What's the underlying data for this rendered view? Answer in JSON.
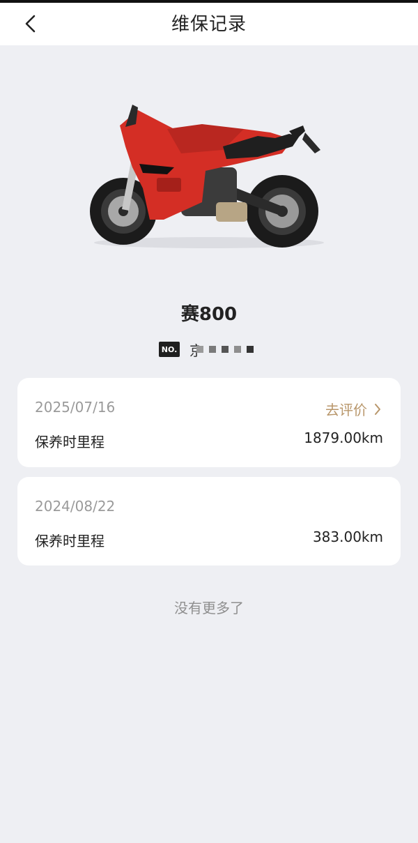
{
  "header": {
    "title": "维保记录"
  },
  "vehicle": {
    "model": "赛800",
    "plate_badge": "NO.",
    "plate_prefix": "京",
    "body_color": "#d42e25"
  },
  "records": [
    {
      "date": "2025/07/16",
      "action_label": "去评价",
      "mileage_label": "保养时里程",
      "mileage_value": "1879.00km"
    },
    {
      "date": "2024/08/22",
      "mileage_label": "保养时里程",
      "mileage_value": "383.00km"
    }
  ],
  "footer": {
    "end_text": "没有更多了"
  },
  "colors": {
    "background": "#eeeff3",
    "accent": "#b8966a",
    "card": "#ffffff"
  },
  "icons": {
    "back": "chevron-left-icon",
    "action_arrow": "chevron-right-icon"
  }
}
